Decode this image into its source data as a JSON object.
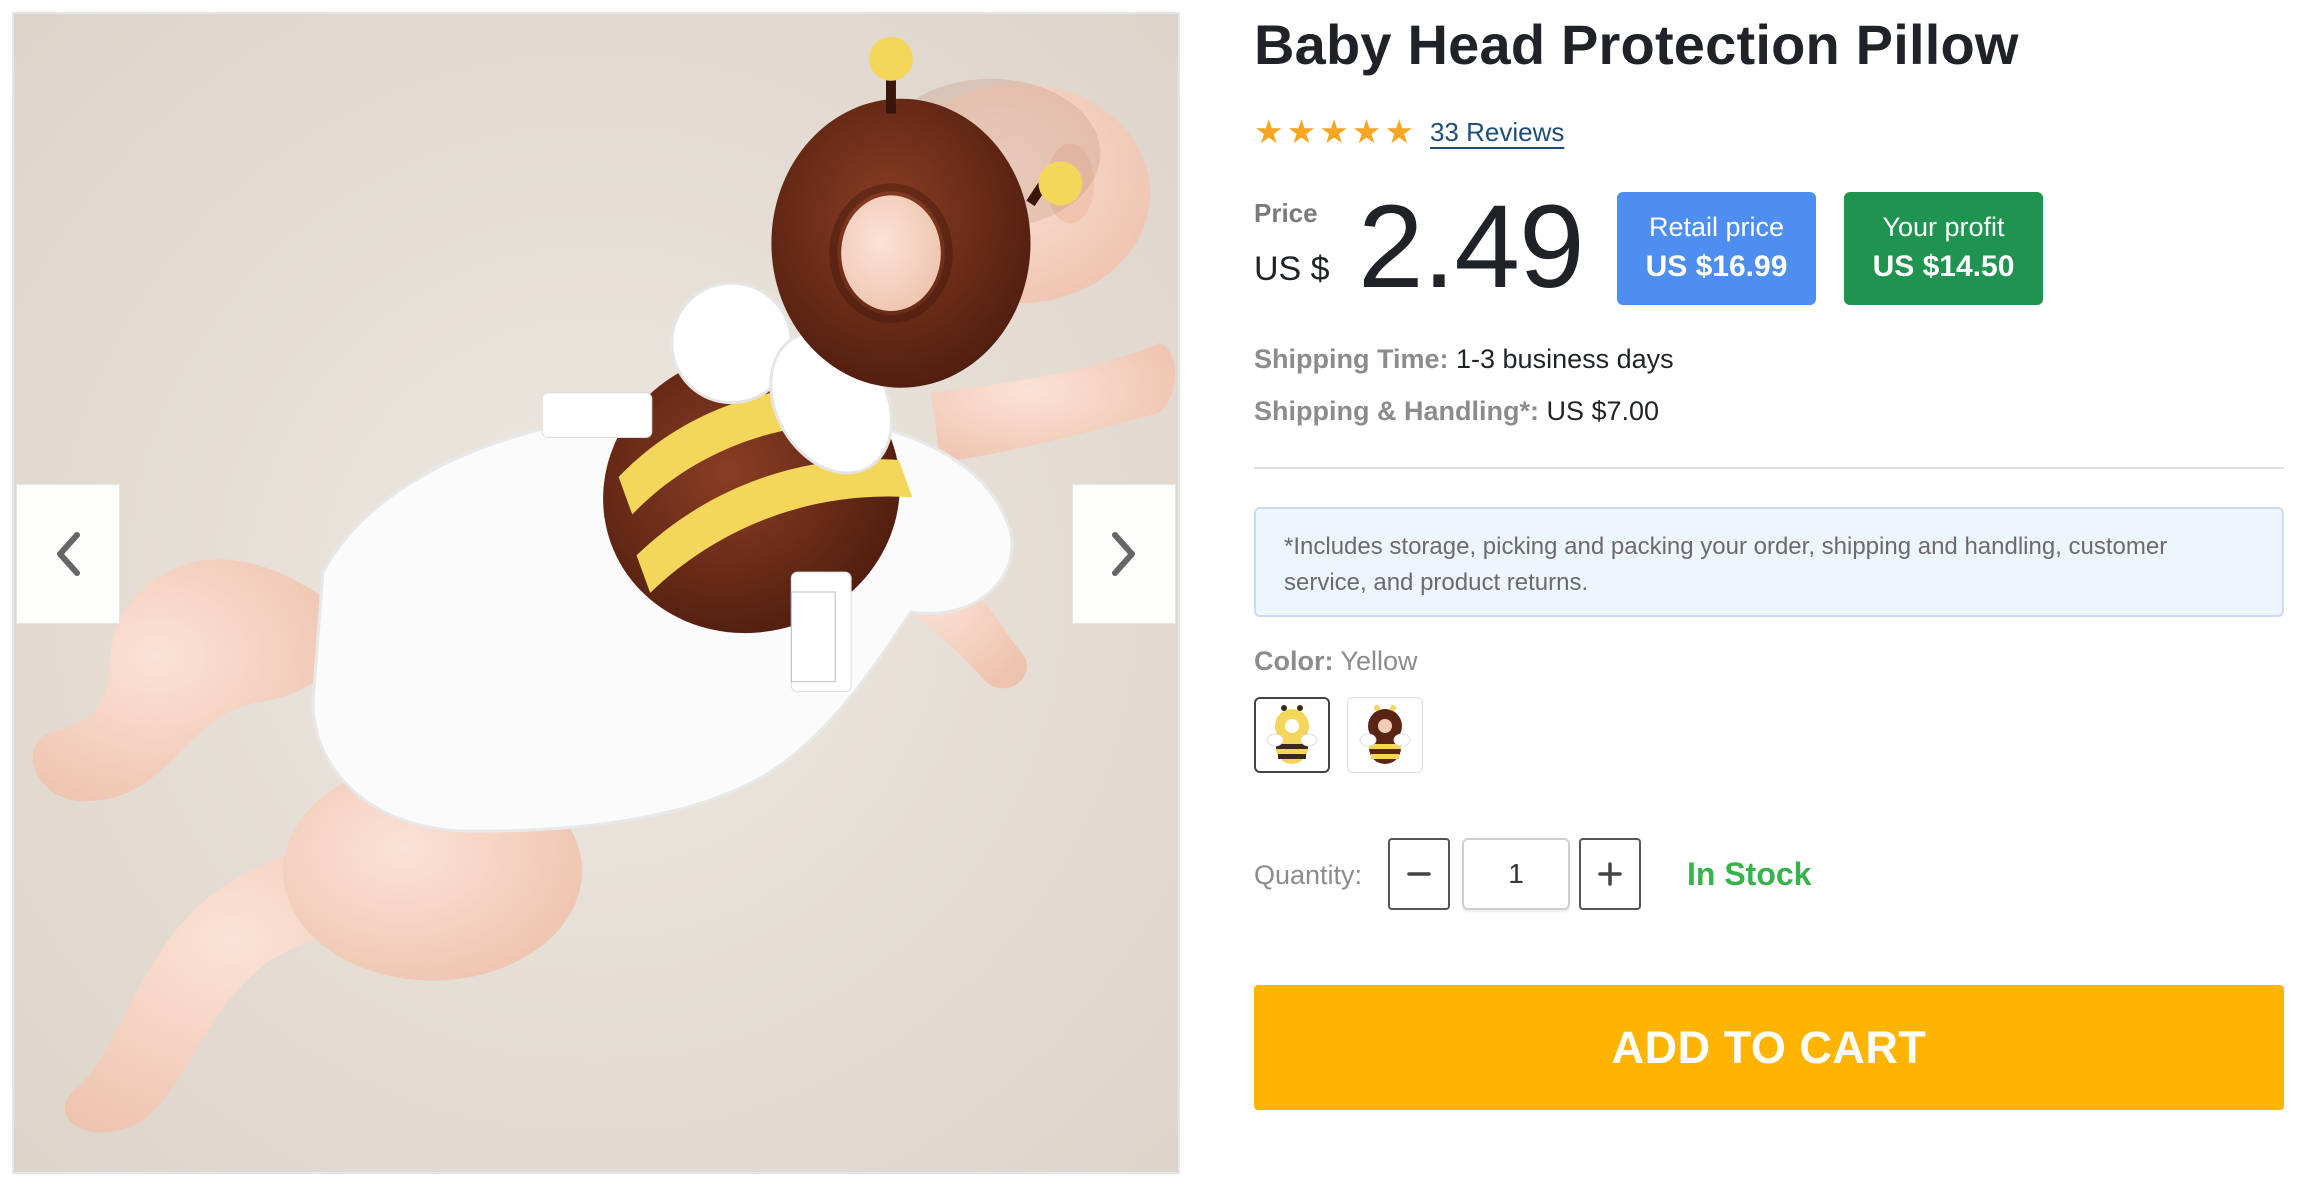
{
  "product": {
    "title": "Baby Head Protection Pillow",
    "rating": 5,
    "reviews_label": "33 Reviews",
    "image_alt": "Baby crawling wearing a bee-shaped head protection backpack pillow"
  },
  "gallery": {
    "prev_icon": "chevron-left-icon",
    "next_icon": "chevron-right-icon"
  },
  "pricing": {
    "price_label": "Price",
    "currency": "US $",
    "price": "2.49",
    "retail_label": "Retail price",
    "retail_value": "US $16.99",
    "profit_label": "Your profit",
    "profit_value": "US $14.50"
  },
  "shipping": {
    "time_label": "Shipping Time:",
    "time_value": "1-3 business days",
    "handling_label": "Shipping & Handling*:",
    "handling_value": "US $7.00",
    "note": "*Includes storage, picking and packing your order, shipping and handling, customer service, and product returns."
  },
  "color": {
    "label": "Color:",
    "selected": "Yellow"
  },
  "quantity": {
    "label": "Quantity:",
    "value": "1",
    "stock": "In Stock"
  },
  "cart": {
    "button_label": "ADD TO CART"
  },
  "colors": {
    "star": "#f5a623",
    "retail_bg": "#4e8ef0",
    "profit_bg": "#1f9350",
    "in_stock": "#36b34a",
    "cart_bg": "#ffb400"
  }
}
